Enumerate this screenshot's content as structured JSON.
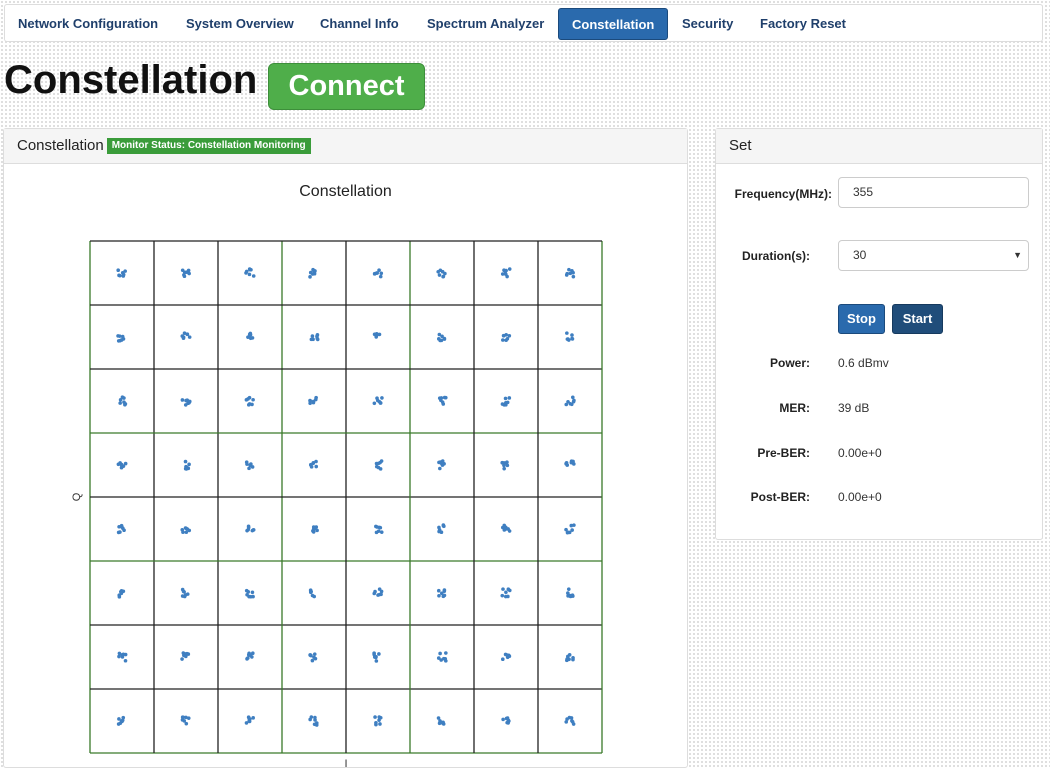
{
  "nav": {
    "tabs": [
      {
        "label": "Network Configuration"
      },
      {
        "label": "System Overview"
      },
      {
        "label": "Channel Info"
      },
      {
        "label": "Spectrum Analyzer"
      },
      {
        "label": "Constellation",
        "active": true
      },
      {
        "label": "Security"
      },
      {
        "label": "Factory Reset"
      }
    ]
  },
  "page": {
    "title": "Constellation",
    "connect_label": "Connect"
  },
  "colors": {
    "active_tab": "#2a6aad",
    "connect": "#4fae4a",
    "badge": "#3a9c3a",
    "points": "#3f7fc1"
  },
  "left_panel": {
    "title": "Constellation",
    "status_badge": "Monitor Status: Constellation Monitoring"
  },
  "set_panel": {
    "title": "Set",
    "frequency_label": "Frequency(MHz):",
    "frequency_value": "355",
    "duration_label": "Duration(s):",
    "duration_value": "30",
    "stop_label": "Stop",
    "start_label": "Start",
    "stats": [
      {
        "label": "Power:",
        "value": "0.6 dBmv"
      },
      {
        "label": "MER:",
        "value": "39 dB"
      },
      {
        "label": "Pre-BER:",
        "value": "0.00e+0"
      },
      {
        "label": "Post-BER:",
        "value": "0.00e+0"
      }
    ]
  },
  "chart_data": {
    "type": "scatter",
    "title": "Constellation",
    "xlabel": "I",
    "ylabel": "Q",
    "modulation_grid": "8x8",
    "grid": true,
    "levels": [
      -7,
      -5,
      -3,
      -1,
      1,
      3,
      5,
      7
    ],
    "xlim": [
      -8,
      8
    ],
    "ylim": [
      -8,
      8
    ]
  }
}
